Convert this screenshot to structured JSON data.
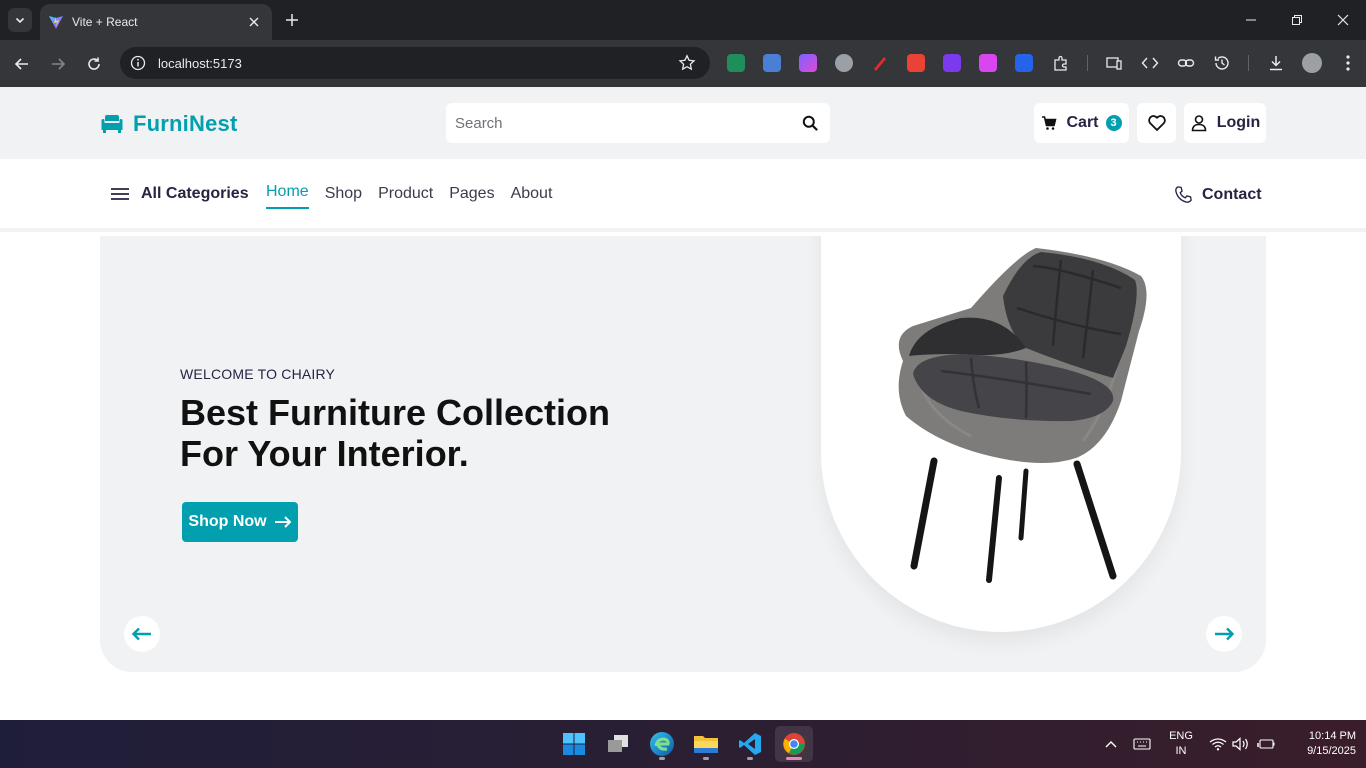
{
  "browser": {
    "tab": {
      "title": "Vite + React"
    },
    "address": {
      "url": "localhost:5173"
    }
  },
  "header": {
    "logo": "FurniNest",
    "search": {
      "placeholder": "Search"
    },
    "cart": {
      "label": "Cart",
      "count": "3"
    },
    "login": {
      "label": "Login"
    }
  },
  "nav": {
    "all_categories": "All Categories",
    "links": [
      "Home",
      "Shop",
      "Product",
      "Pages",
      "About"
    ],
    "active": "Home",
    "contact": "Contact"
  },
  "hero": {
    "eyebrow": "WELCOME TO CHAIRY",
    "title_line1": "Best Furniture Collection",
    "title_line2": "For Your Interior.",
    "cta": "Shop Now"
  },
  "taskbar": {
    "language": "ENG",
    "region": "IN",
    "time": "10:14 PM",
    "date": "9/15/2025"
  },
  "colors": {
    "brand": "#029fae",
    "text_dark": "#272343",
    "hero_bg": "#f0f2f3"
  }
}
